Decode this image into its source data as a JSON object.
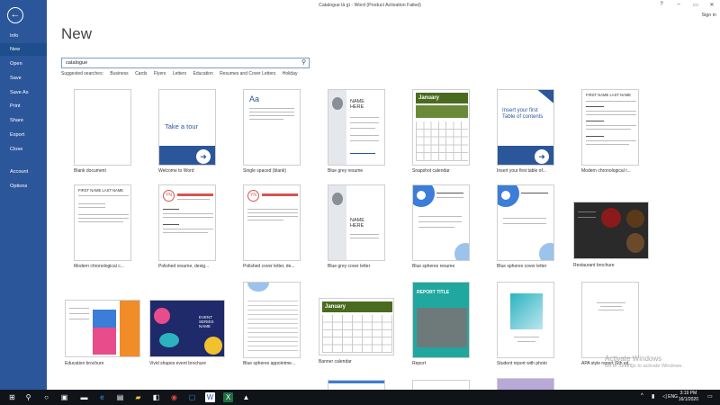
{
  "window": {
    "title": "Catalogue là gì - Word (Product Activation Failed)",
    "help": "?",
    "minimize": "–",
    "restore": "▭",
    "close": "✕",
    "signin": "Sign in"
  },
  "sidebar": {
    "back_icon": "←",
    "items": [
      {
        "label": "Info"
      },
      {
        "label": "New"
      },
      {
        "label": "Open"
      },
      {
        "label": "Save"
      },
      {
        "label": "Save As"
      },
      {
        "label": "Print"
      },
      {
        "label": "Share"
      },
      {
        "label": "Export"
      },
      {
        "label": "Close"
      },
      {
        "label": "Account"
      },
      {
        "label": "Options"
      }
    ],
    "active": "New"
  },
  "main": {
    "title": "New",
    "search": {
      "value": "catalogue",
      "icon": "⚲"
    },
    "suggested": {
      "label": "Suggested searches:",
      "tags": [
        "Business",
        "Cards",
        "Flyers",
        "Letters",
        "Education",
        "Resumes and Cover Letters",
        "Holiday"
      ]
    }
  },
  "templates": [
    {
      "name": "Blank document"
    },
    {
      "name": "Welcome to Word",
      "text": "Take a tour"
    },
    {
      "name": "Single spaced (blank)",
      "text": "Aa"
    },
    {
      "name": "Blue grey resume",
      "text": "NAME HERE"
    },
    {
      "name": "Snapshot calendar",
      "text": "January"
    },
    {
      "name": "Insert your first table of...",
      "text": "Insert your first Table of contents"
    },
    {
      "name": "Modern chronological r...",
      "text": "FIRST NAME LAST NAME"
    },
    {
      "name": "Modern chronological c...",
      "text": "FIRST NAME LAST NAME"
    },
    {
      "name": "Polished resume, desig...",
      "text": "YN"
    },
    {
      "name": "Polished cover letter, de...",
      "text": "YN"
    },
    {
      "name": "Blue grey cover letter",
      "text": "NAME HERE"
    },
    {
      "name": "Blue spheres resume"
    },
    {
      "name": "Blue spheres cover letter"
    },
    {
      "name": "Restaurant brochure"
    },
    {
      "name": "Education brochure"
    },
    {
      "name": "Vivid shapes event brochure",
      "text": "EVENT SERIES NAME"
    },
    {
      "name": "Blue spheres appointme..."
    },
    {
      "name": "Banner calendar",
      "text": "January"
    },
    {
      "name": "Report",
      "text": "REPORT TITLE"
    },
    {
      "name": "Student report with photo"
    },
    {
      "name": "APA style report (6th ed..."
    }
  ],
  "watermark": {
    "line1": "Activate Windows",
    "line2": "Go to Settings to activate Windows."
  },
  "taskbar": {
    "time": "3:19 PM",
    "date": "16/1/2020",
    "lang": "ENG"
  },
  "colors": {
    "accent": "#2b579a",
    "taskbar": "#101418"
  }
}
